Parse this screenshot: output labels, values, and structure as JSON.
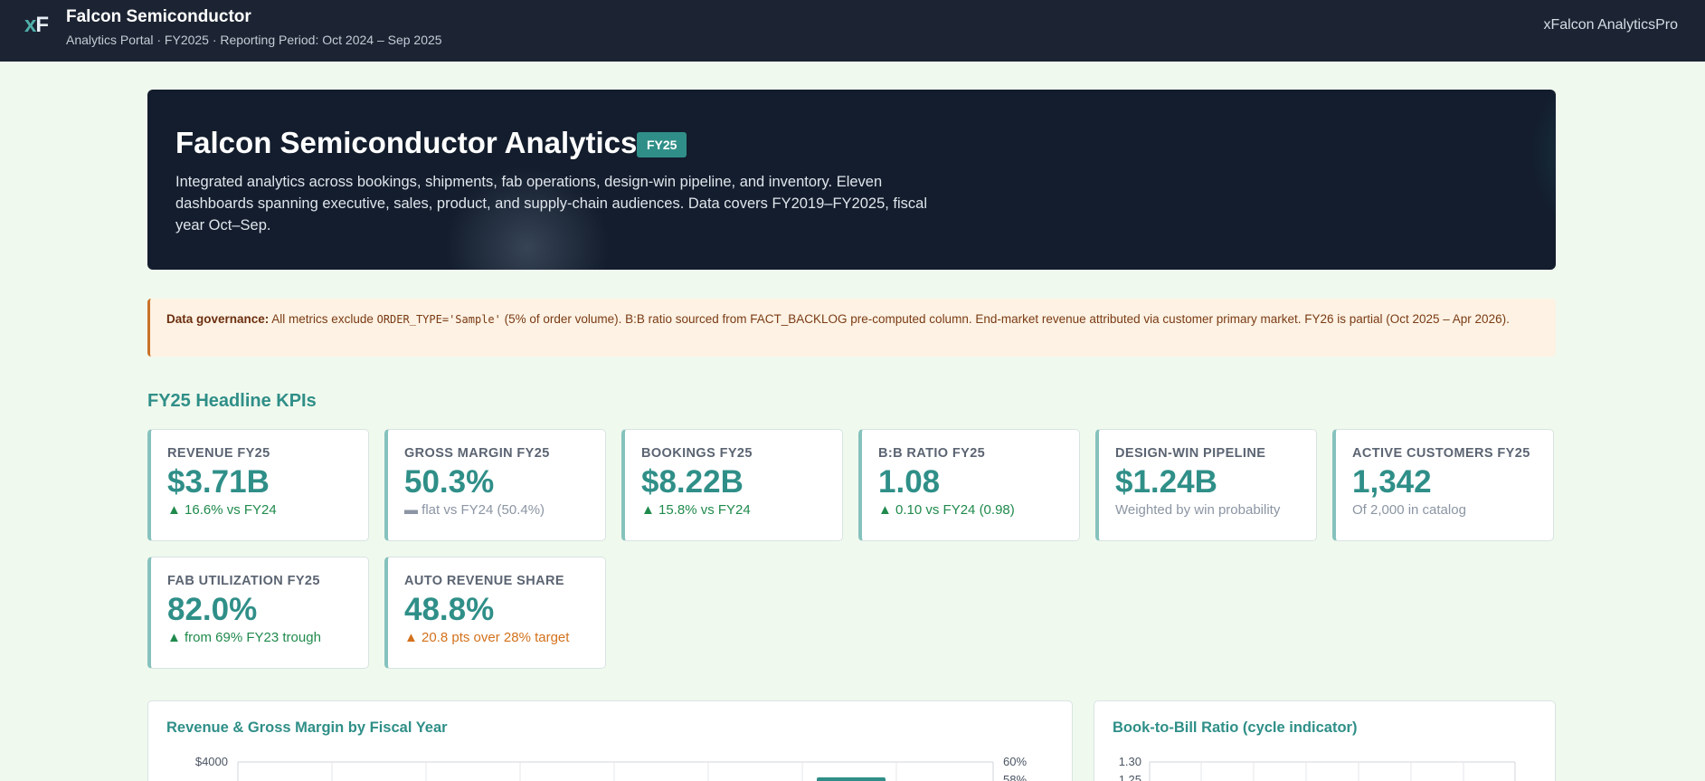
{
  "topbar": {
    "logo": {
      "x": "x",
      "f": "F"
    },
    "title": "Falcon Semiconductor",
    "subtitle": "Analytics Portal · FY2025 · Reporting Period: Oct 2024 – Sep 2025",
    "right_label": "xFalcon AnalyticsPro"
  },
  "hero": {
    "title": "Falcon Semiconductor Analytics",
    "badge": "FY25",
    "description": "Integrated analytics across bookings, shipments, fab operations, design-win pipeline, and inventory. Eleven dashboards spanning executive, sales, product, and supply-chain audiences. Data covers FY2019–FY2025, fiscal year Oct–Sep."
  },
  "governance": {
    "label": "Data governance:",
    "text_1": " All metrics exclude ",
    "code": "ORDER_TYPE='Sample'",
    "text_2": " (5% of order volume). B:B ratio sourced from FACT_BACKLOG pre-computed column. End-market revenue attributed via customer primary market. FY26 is partial (Oct 2025 – Apr 2026)."
  },
  "kpi_section_title": "FY25 Headline KPIs",
  "kpis": [
    {
      "label": "REVENUE FY25",
      "value": "$3.71B",
      "note": "▲ 16.6% vs FY24"
    },
    {
      "label": "GROSS MARGIN FY25",
      "value": "50.3%",
      "note": "▬ flat vs FY24 (50.4%)"
    },
    {
      "label": "BOOKINGS FY25",
      "value": "$8.22B",
      "note": "▲ 15.8% vs FY24"
    },
    {
      "label": "B:B RATIO FY25",
      "value": "1.08",
      "note": "▲ 0.10 vs FY24 (0.98)"
    },
    {
      "label": "DESIGN-WIN PIPELINE",
      "value": "$1.24B",
      "note": "Weighted by win probability"
    },
    {
      "label": "ACTIVE CUSTOMERS FY25",
      "value": "1,342",
      "note": "Of 2,000 in catalog"
    },
    {
      "label": "FAB UTILIZATION FY25",
      "value": "82.0%",
      "note": "▲ from 69% FY23 trough"
    },
    {
      "label": "AUTO REVENUE SHARE",
      "value": "48.8%",
      "note": "▲ 20.8 pts over 28% target"
    }
  ],
  "charts": {
    "revenue": {
      "title": "Revenue & Gross Margin by Fiscal Year",
      "y_left_top": "$4000",
      "y_right_top": "60%",
      "y_right_second": "58%"
    },
    "btb": {
      "title": "Book-to-Bill Ratio (cycle indicator)",
      "y_top": "1.30",
      "y_second": "1.25"
    }
  },
  "colors": {
    "accent": "#2f8f88",
    "topbar": "#1c2433",
    "warning": "#c9722a"
  }
}
